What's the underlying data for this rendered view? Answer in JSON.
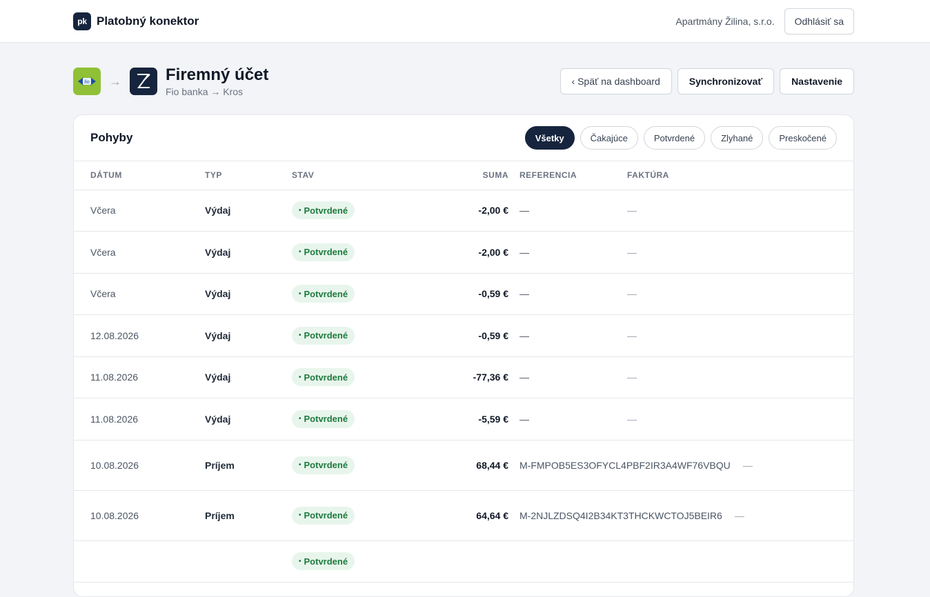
{
  "topbar": {
    "brand_logo": "pk",
    "brand_name": "Platobný konektor",
    "company": "Apartmány Žilina, s.r.o.",
    "logout_label": "Odhlásiť sa"
  },
  "header": {
    "title": "Firemný účet",
    "subtitle": "Fio banka → Kros",
    "arrow": "→",
    "back_label": "‹ Späť na dashboard",
    "sync_label": "Synchronizovať",
    "settings_label": "Nastavenie"
  },
  "card": {
    "title": "Pohyby",
    "filters": [
      "Všetky",
      "Čakajúce",
      "Potvrdené",
      "Zlyhané",
      "Preskočené"
    ],
    "active_filter": "Všetky",
    "columns": [
      "DÁTUM",
      "TYP",
      "STAV",
      "SUMA",
      "REFERENCIA",
      "FAKTÚRA"
    ],
    "rows": [
      {
        "date": "Včera",
        "type": "Výdaj",
        "state": "Potvrdené",
        "sum": "-2,00 €",
        "ref": "—",
        "invoice": "—"
      },
      {
        "date": "Včera",
        "type": "Výdaj",
        "state": "Potvrdené",
        "sum": "-2,00 €",
        "ref": "—",
        "invoice": "—"
      },
      {
        "date": "Včera",
        "type": "Výdaj",
        "state": "Potvrdené",
        "sum": "-0,59 €",
        "ref": "—",
        "invoice": "—"
      },
      {
        "date": "12.08.2026",
        "type": "Výdaj",
        "state": "Potvrdené",
        "sum": "-0,59 €",
        "ref": "—",
        "invoice": "—"
      },
      {
        "date": "11.08.2026",
        "type": "Výdaj",
        "state": "Potvrdené",
        "sum": "-77,36 €",
        "ref": "—",
        "invoice": "—"
      },
      {
        "date": "11.08.2026",
        "type": "Výdaj",
        "state": "Potvrdené",
        "sum": "-5,59 €",
        "ref": "—",
        "invoice": "—"
      },
      {
        "date": "10.08.2026",
        "type": "Príjem",
        "state": "Potvrdené",
        "sum": "68,44 €",
        "ref": "M-FMPOB5ES3OFYCL4PBF2IR3A4WF76VBQU",
        "invoice": "—"
      },
      {
        "date": "10.08.2026",
        "type": "Príjem",
        "state": "Potvrdené",
        "sum": "64,64 €",
        "ref": "M-2NJLZDSQ4I2B34KT3THCKWCTOJ5BEIR6",
        "invoice": "—"
      },
      {
        "date": "",
        "type": "",
        "state": "Potvrdené",
        "sum": "",
        "ref": "",
        "invoice": ""
      }
    ]
  },
  "colors": {
    "brand_dark": "#16253d",
    "fio_green": "#8fc035",
    "badge_green_bg": "#e8f5ec",
    "badge_green_text": "#1e7a3e"
  }
}
